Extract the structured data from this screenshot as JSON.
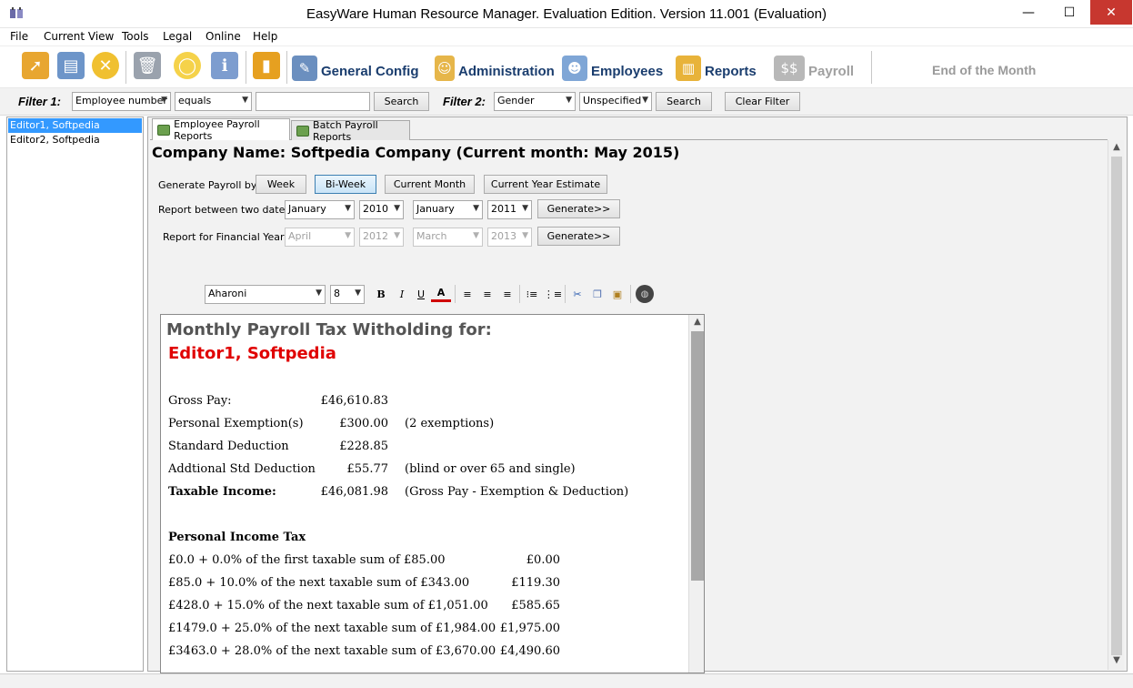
{
  "window": {
    "title": "EasyWare Human Resource Manager. Evaluation Edition. Version 11.001 (Evaluation)",
    "min": "—",
    "max": "☐",
    "close": "✕"
  },
  "menu": [
    "File",
    "Current View",
    "Tools",
    "Legal",
    "Online",
    "Help"
  ],
  "toolbar": {
    "general_config": "General Config",
    "administration": "Administration",
    "employees": "Employees",
    "reports": "Reports",
    "payroll": "Payroll",
    "end_of_month": "End of the Month"
  },
  "filter": {
    "label1": "Filter 1:",
    "field1": "Employee number",
    "operator1": "equals",
    "value1": "",
    "search1": "Search",
    "label2": "Filter 2:",
    "field2": "Gender",
    "value2": "Unspecified",
    "search2": "Search",
    "clear": "Clear Filter"
  },
  "employees": [
    "Editor1, Softpedia",
    "Editor2, Softpedia"
  ],
  "tabs": [
    "Employee Payroll Reports",
    "Batch Payroll Reports"
  ],
  "company": "Company Name: Softpedia Company  (Current month: May  2015)",
  "payroll": {
    "generate_label": "Generate Payroll by:",
    "week": "Week",
    "biweek": "Bi-Week",
    "current_month": "Current Month",
    "year_estimate": "Current Year Estimate",
    "between_label": "Report between two dates:",
    "from_month": "January",
    "from_year": "2010",
    "to_month": "January",
    "to_year": "2011",
    "generate": "Generate>>",
    "financial_label": "Report for Financial Year:",
    "fin_from_month": "April",
    "fin_from_year": "2012",
    "fin_to_month": "March",
    "fin_to_year": "2013",
    "generate2": "Generate>>"
  },
  "editor": {
    "font": "Aharoni",
    "size": "8",
    "bold": "B",
    "italic": "I",
    "underline": "U",
    "color": "A"
  },
  "report": {
    "title": "Monthly Payroll Tax Witholding for:",
    "name": "Editor1, Softpedia",
    "rows": [
      {
        "label": "Gross Pay:",
        "value": "£46,610.83",
        "note": ""
      },
      {
        "label": "Personal Exemption(s)",
        "value": "£300.00",
        "note": "(2 exemptions)"
      },
      {
        "label": "Standard Deduction",
        "value": "£228.85",
        "note": ""
      },
      {
        "label": "Addtional Std Deduction",
        "value": "£55.77",
        "note": "(blind or over 65 and single)"
      },
      {
        "label": "Taxable Income:",
        "value": "£46,081.98",
        "note": "(Gross Pay - Exemption & Deduction)"
      }
    ],
    "tax_heading": "Personal Income Tax",
    "tax_rows": [
      {
        "label": "£0.0 + 0.0% of the first taxable sum of £85.00",
        "value": "£0.00"
      },
      {
        "label": "£85.0 + 10.0% of the next taxable sum of £343.00",
        "value": "£119.30"
      },
      {
        "label": "£428.0 + 15.0% of the next taxable sum of £1,051.00",
        "value": "£585.65"
      },
      {
        "label": "£1479.0 + 25.0% of the next taxable sum of £1,984.00",
        "value": "£1,975.00"
      },
      {
        "label": "£3463.0 + 28.0% of the next taxable sum of £3,670.00",
        "value": "£4,490.60"
      }
    ]
  },
  "colors": {
    "accent_selection": "#3399ff",
    "report_name": "#e00000",
    "toolbar_text": "#1a3d6e"
  }
}
